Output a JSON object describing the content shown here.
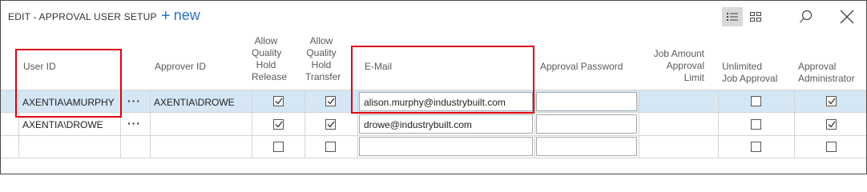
{
  "header": {
    "title": "EDIT - APPROVAL USER SETUP",
    "new_label": "new",
    "icons": [
      "list-view-icon",
      "tile-view-icon",
      "search-icon",
      "close-icon"
    ]
  },
  "columns": {
    "user_id": "User ID",
    "approver_id": "Approver ID",
    "allow_qh_release": [
      "Allow",
      "Quality",
      "Hold",
      "Release"
    ],
    "allow_qh_transfer": [
      "Allow",
      "Quality",
      "Hold",
      "Transfer"
    ],
    "email": "E-Mail",
    "approval_password": "Approval Password",
    "job_amount_limit": [
      "Job Amount",
      "Approval",
      "Limit"
    ],
    "unlimited_job_approval": [
      "Unlimited",
      "Job Approval"
    ],
    "approval_administrator": [
      "Approval",
      "Administrator"
    ]
  },
  "rows": [
    {
      "user_id": "AXENTIA\\AMURPHY",
      "approver_id": "AXENTIA\\DROWE",
      "allow_release": true,
      "allow_transfer": true,
      "email": "alison.murphy@industrybuilt.com",
      "password": "",
      "job_limit": "",
      "unlimited": false,
      "administrator": true,
      "selected": true
    },
    {
      "user_id": "AXENTIA\\DROWE",
      "approver_id": "",
      "allow_release": true,
      "allow_transfer": true,
      "email": "drowe@industrybuilt.com",
      "password": "",
      "job_limit": "",
      "unlimited": false,
      "administrator": true,
      "selected": false
    },
    {
      "user_id": "",
      "approver_id": "",
      "allow_release": false,
      "allow_transfer": false,
      "email": "",
      "password": "",
      "job_limit": "",
      "unlimited": false,
      "administrator": false,
      "selected": false
    }
  ],
  "more_glyph": "···",
  "colors": {
    "accent": "#2b74c7",
    "highlight": "#e0000e",
    "selected_row": "#d5e6f4"
  }
}
